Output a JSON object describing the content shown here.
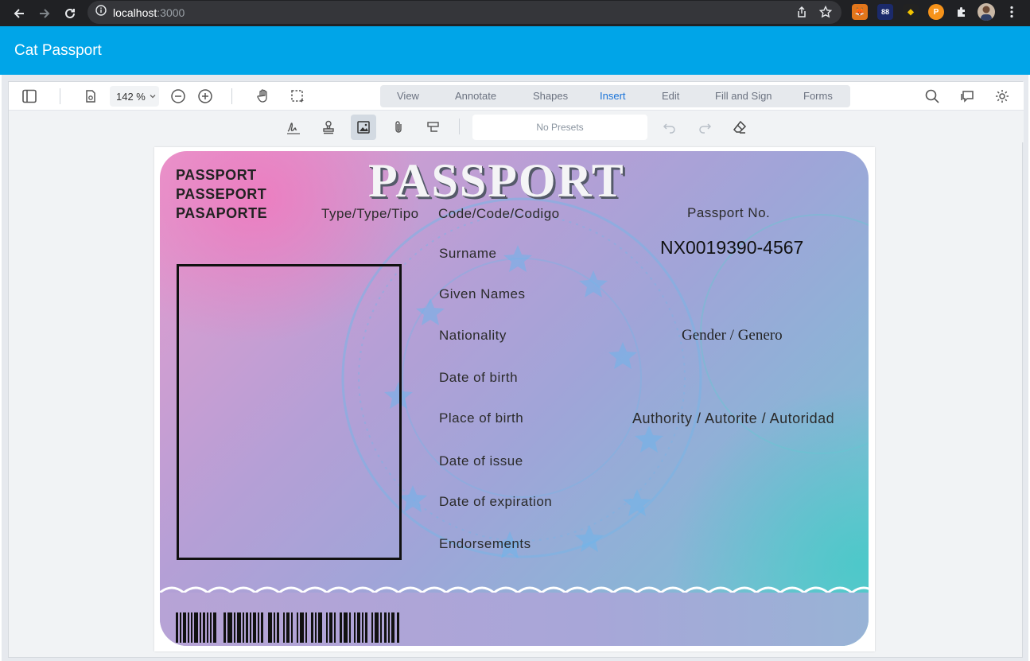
{
  "browser": {
    "url_host": "localhost",
    "url_port": ":3000"
  },
  "app": {
    "title": "Cat Passport"
  },
  "toolbar": {
    "zoom": "142 %",
    "tabs": [
      "View",
      "Annotate",
      "Shapes",
      "Insert",
      "Edit",
      "Fill and Sign",
      "Forms"
    ],
    "active_tab": "Insert",
    "presets_placeholder": "No Presets"
  },
  "passport": {
    "header_lines": [
      "PASSPORT",
      "PASSEPORT",
      "PASAPORTE"
    ],
    "title": "PASSPORT",
    "type_label": "Type/Type/Tipo",
    "code_label": "Code/Code/Codigo",
    "passport_no_label": "Passport No.",
    "passport_no_value": "NX0019390-4567",
    "fields": [
      "Surname",
      "Given Names",
      "Nationality",
      "Date of birth",
      "Place of birth",
      "Date of issue",
      "Date of expiration",
      "Endorsements"
    ],
    "gender_label": "Gender / Genero",
    "authority_label": "Authority / Autorite / Autoridad"
  },
  "colors": {
    "header_bg": "#00a5e8",
    "active_tab": "#1a73d8"
  }
}
